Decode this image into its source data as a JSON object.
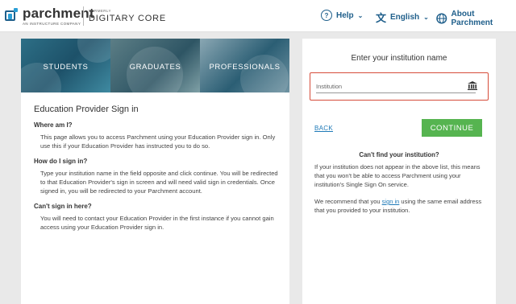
{
  "header": {
    "logo_name": "parchment",
    "logo_sub": "AN INSTRUCTURE COMPANY",
    "formerly_label": "FORMERLY",
    "formerly_name": "DIGITARY CORE",
    "help_label": "Help",
    "help_icon": "question-circle-icon",
    "language_label": "English",
    "language_icon": "translate-icon",
    "about_label": "About Parchment",
    "about_icon": "globe-icon",
    "link_color": "#1f5f8b"
  },
  "banner": {
    "panels": [
      {
        "label": "STUDENTS"
      },
      {
        "label": "GRADUATES"
      },
      {
        "label": "PROFESSIONALS"
      }
    ]
  },
  "info": {
    "title": "Education Provider Sign in",
    "q1": "Where am I?",
    "a1": "This page allows you to access Parchment using your Education Provider sign in. Only use this if your Education Provider has instructed you to do so.",
    "q2": "How do I sign in?",
    "a2": "Type your institution name in the field opposite and click continue. You will be redirected to that Education Provider's sign in screen and will need valid sign in credentials. Once signed in, you will be redirected to your Parchment account.",
    "q3": "Can't sign in here?",
    "a3": "You will need to contact your Education Provider in the first instance if you cannot gain access using your Education Provider sign in."
  },
  "institution": {
    "title": "Enter your institution name",
    "placeholder": "Institution",
    "value": "",
    "field_icon": "bank-icon",
    "highlight_color": "#d64c3a",
    "back_label": "BACK",
    "continue_label": "CONTINUE",
    "continue_color": "#56b450",
    "cant_find_title": "Can't find your institution?",
    "cant_find_text": "If your institution does not appear in the above list, this means that you won't be able to access Parchment using your institution's Single Sign On service.",
    "recommend_prefix": "We recommend that you ",
    "recommend_link": "sign in",
    "recommend_suffix": " using the same email address that you provided to your institution."
  }
}
